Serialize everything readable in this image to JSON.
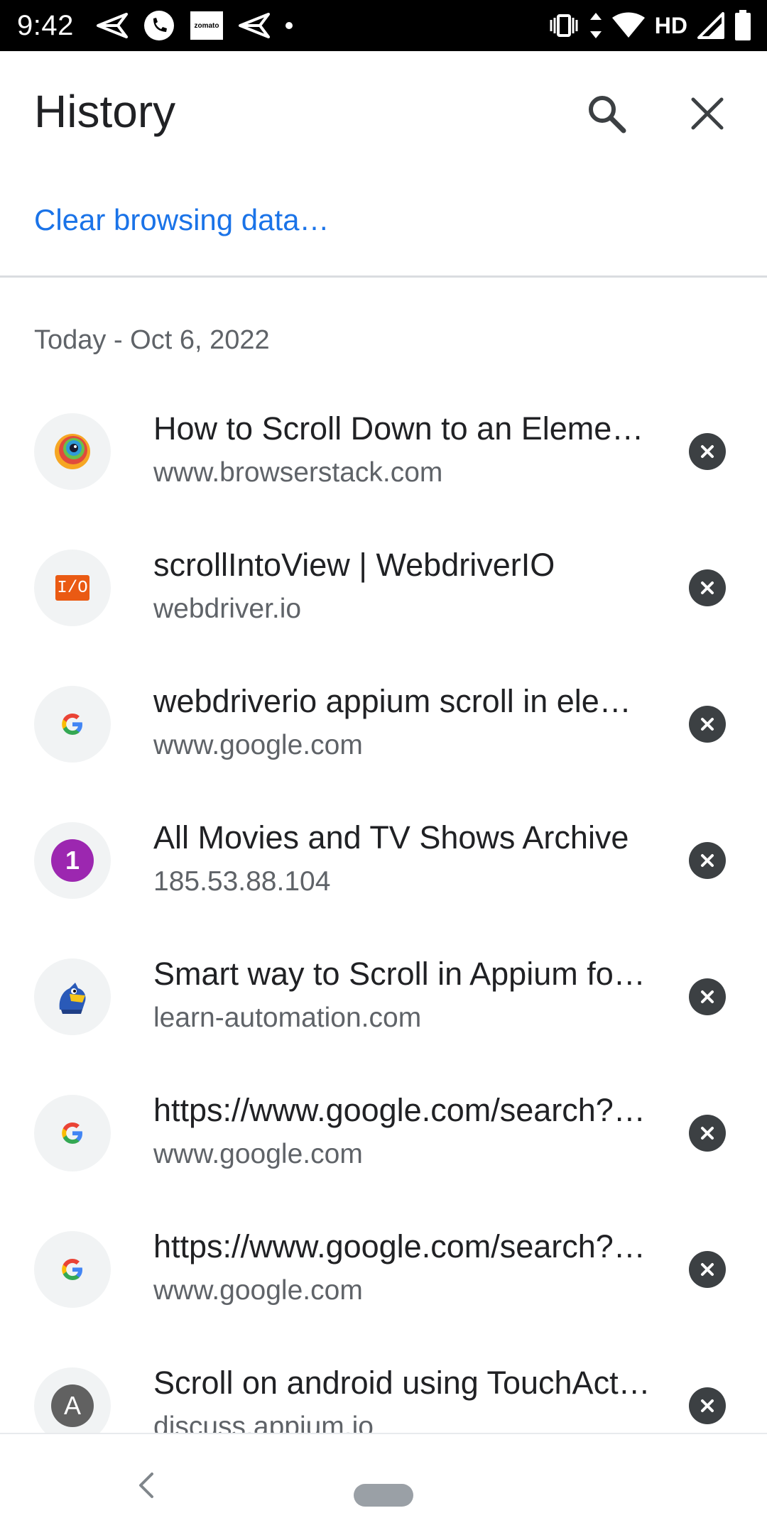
{
  "status_bar": {
    "time": "9:42",
    "left_icons": [
      "send-icon",
      "phone-icon",
      "zomato-icon",
      "send-icon",
      "dot-icon"
    ],
    "zomato_label": "zomato",
    "network_label": "HD",
    "right_icons": [
      "vibrate-icon",
      "data-arrows-icon",
      "wifi-icon",
      "signal-icon",
      "battery-icon"
    ]
  },
  "header": {
    "title": "History",
    "search_icon": "search-icon",
    "close_icon": "close-icon"
  },
  "clear_link": "Clear browsing data…",
  "date_header": "Today - Oct 6, 2022",
  "items": [
    {
      "title": "How to Scroll Down to an Element in Appium",
      "url": "www.browserstack.com",
      "favicon": "browserstack-icon"
    },
    {
      "title": "scrollIntoView | WebdriverIO",
      "url": "webdriver.io",
      "favicon": "webdriverio-icon",
      "favicon_text": "I/O"
    },
    {
      "title": "webdriverio appium scroll in element - Google Search",
      "url": "www.google.com",
      "favicon": "google-icon",
      "favicon_text": "G"
    },
    {
      "title": "All Movies and TV Shows Archive",
      "url": "185.53.88.104",
      "favicon": "number-icon",
      "favicon_text": "1"
    },
    {
      "title": "Smart way to Scroll in Appium for Android",
      "url": "learn-automation.com",
      "favicon": "learn-automation-icon"
    },
    {
      "title": "https://www.google.com/search?q=appium",
      "url": "www.google.com",
      "favicon": "google-icon",
      "favicon_text": "G"
    },
    {
      "title": "https://www.google.com/search?q=webdriverio",
      "url": "www.google.com",
      "favicon": "google-icon",
      "favicon_text": "G"
    },
    {
      "title": "Scroll on android using TouchAction",
      "url": "discuss.appium.io",
      "favicon": "letter-icon",
      "favicon_text": "A"
    }
  ],
  "nav": {
    "back_icon": "back-icon",
    "home_icon": "home-pill-icon"
  },
  "colors": {
    "accent": "#1a73e8",
    "text": "#202124",
    "secondary": "#5f6368",
    "remove": "#3c4043"
  }
}
